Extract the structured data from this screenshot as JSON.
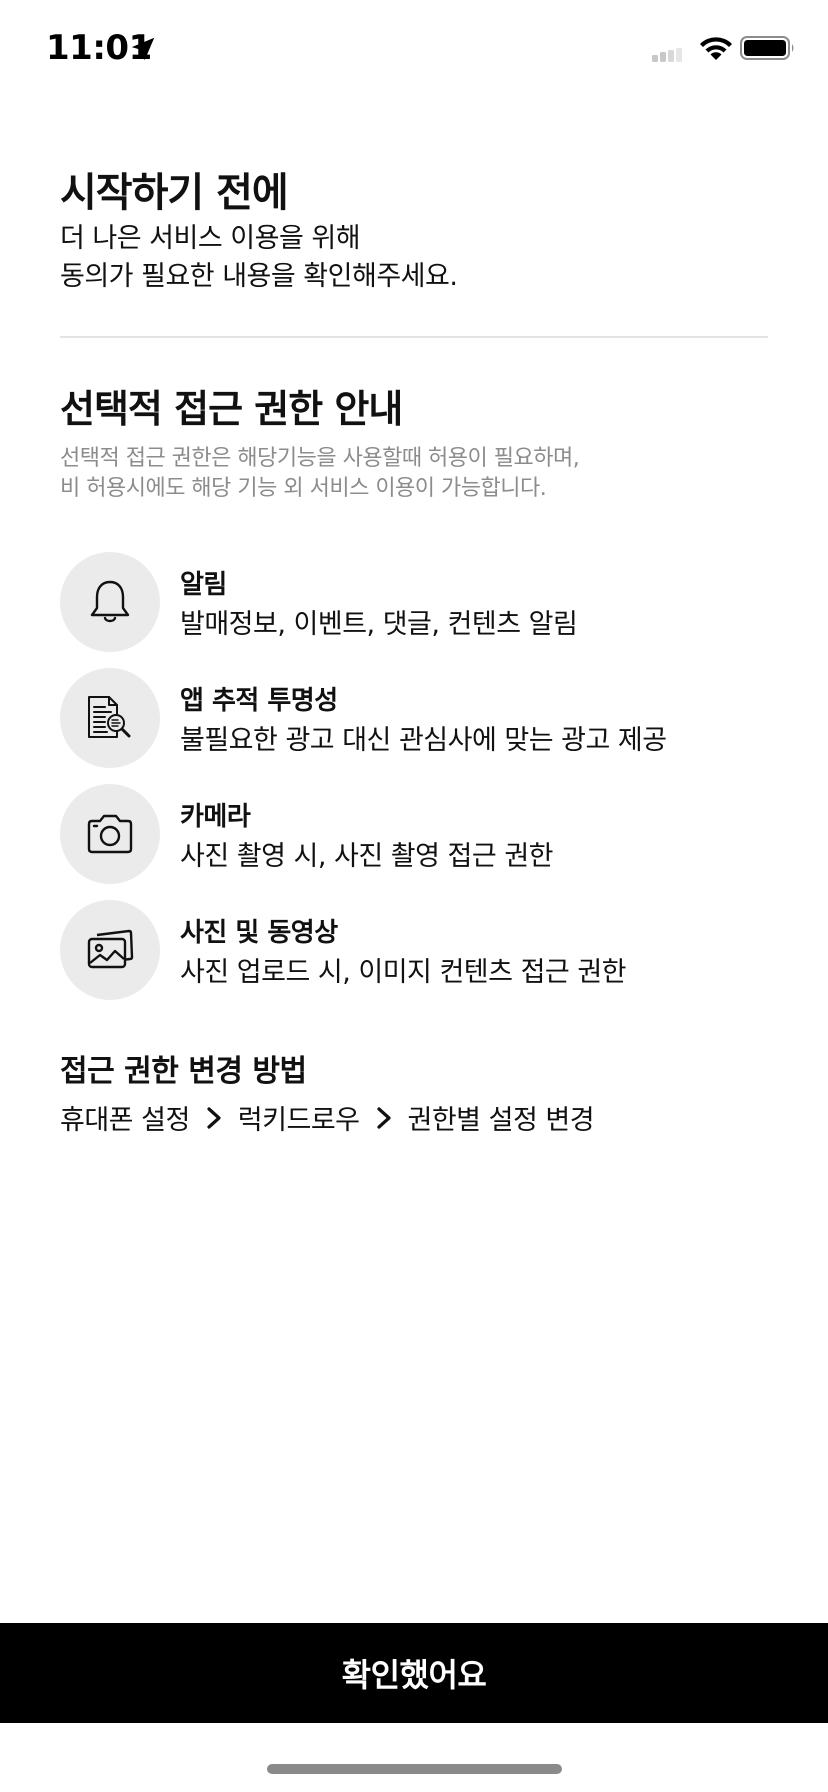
{
  "status_bar": {
    "time": "11:01",
    "icons": [
      "location-arrow-icon",
      "cellular-signal-icon",
      "wifi-icon",
      "battery-icon"
    ]
  },
  "intro": {
    "title": "시작하기 전에",
    "desc_line1": "더 나은 서비스 이용을 위해",
    "desc_line2": "동의가 필요한 내용을 확인해주세요."
  },
  "optional": {
    "title": "선택적 접근 권한 안내",
    "desc_line1": "선택적 접근 권한은 해당기능을 사용할때 허용이 필요하며,",
    "desc_line2": "비 허용시에도 해당 기능 외 서비스 이용이 가능합니다."
  },
  "permissions": [
    {
      "icon": "bell-icon",
      "name": "알림",
      "desc": "발매정보, 이벤트, 댓글, 컨텐츠 알림"
    },
    {
      "icon": "tracking-document-icon",
      "name": "앱 추적 투명성",
      "desc": "불필요한 광고 대신 관심사에 맞는 광고 제공"
    },
    {
      "icon": "camera-icon",
      "name": "카메라",
      "desc": "사진 촬영 시, 사진 촬영 접근 권한"
    },
    {
      "icon": "photos-icon",
      "name": "사진 및 동영상",
      "desc": "사진 업로드 시, 이미지 컨텐츠 접근 권한"
    }
  ],
  "change": {
    "title": "접근 권한 변경 방법",
    "path": [
      "휴대폰 설정",
      "럭키드로우",
      "권한별 설정 변경"
    ]
  },
  "confirm_button": {
    "label": "확인했어요"
  },
  "colors": {
    "button_bg": "#000000",
    "button_text": "#ffffff",
    "icon_circle_bg": "#ebebeb",
    "muted_text": "#8c8c8c",
    "divider": "#e3e3e3"
  }
}
